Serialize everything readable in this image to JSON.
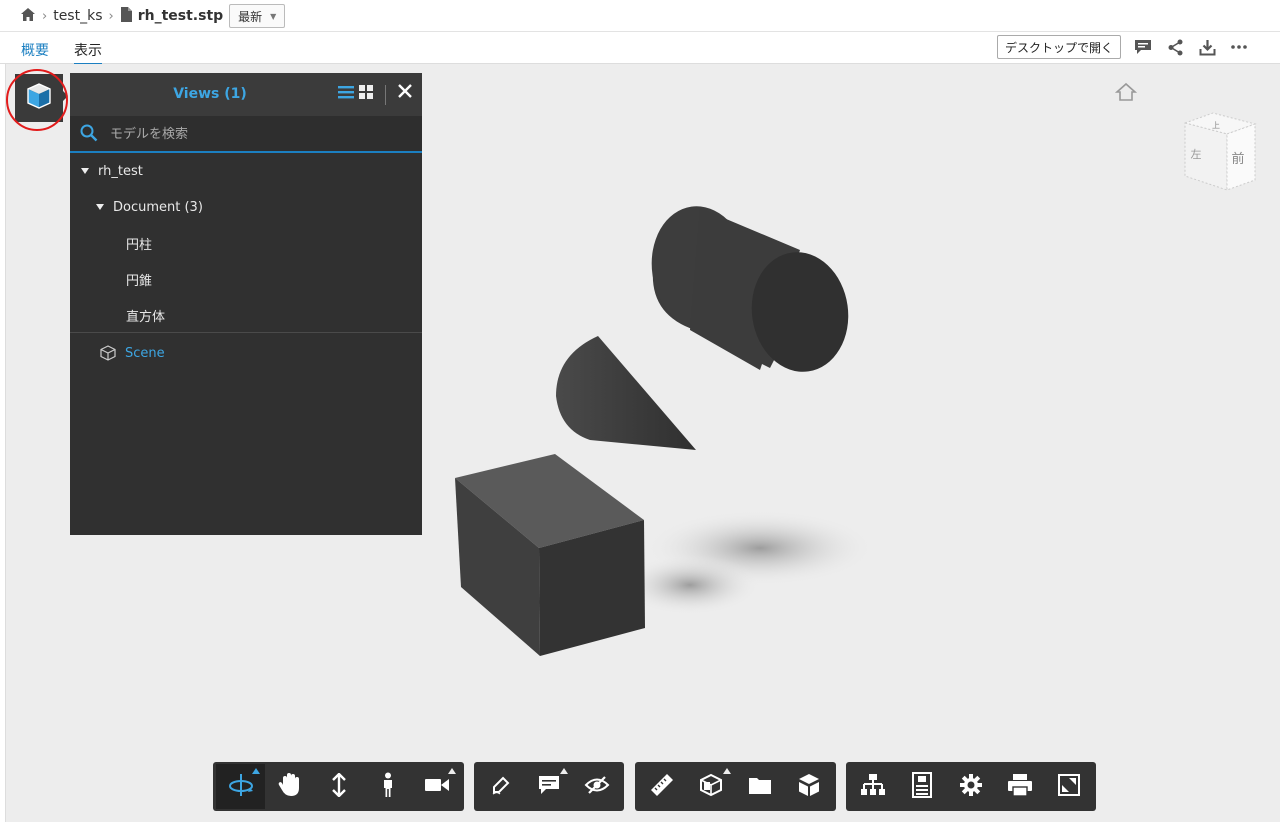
{
  "breadcrumb": {
    "folder": "test_ks",
    "file": "rh_test.stp",
    "version": "最新"
  },
  "tabs": {
    "overview": "概要",
    "view": "表示"
  },
  "header": {
    "open_desktop": "デスクトップで開く"
  },
  "panel": {
    "title": "Views (1)",
    "search_placeholder": "モデルを検索",
    "tree": {
      "root": "rh_test",
      "document": "Document (3)",
      "items": [
        "円柱",
        "円錐",
        "直方体"
      ],
      "scene": "Scene"
    }
  },
  "viewcube": {
    "top": "上",
    "front": "前",
    "left": "左"
  },
  "toolbar": {
    "groups": [
      [
        "orbit-icon",
        "pan-icon",
        "zoom-icon",
        "walk-icon",
        "camera-icon"
      ],
      [
        "markup-icon",
        "comment-icon",
        "hide-icon"
      ],
      [
        "measure-icon",
        "section-icon",
        "explode-icon",
        "model-browser-icon"
      ],
      [
        "structure-icon",
        "properties-icon",
        "settings-icon",
        "print-icon",
        "fullscreen-icon"
      ]
    ]
  },
  "colors": {
    "accent": "#1b7fc1",
    "panel_bg": "#303030",
    "toolbar_bg": "#333333",
    "annotation": "#e21b1b"
  }
}
